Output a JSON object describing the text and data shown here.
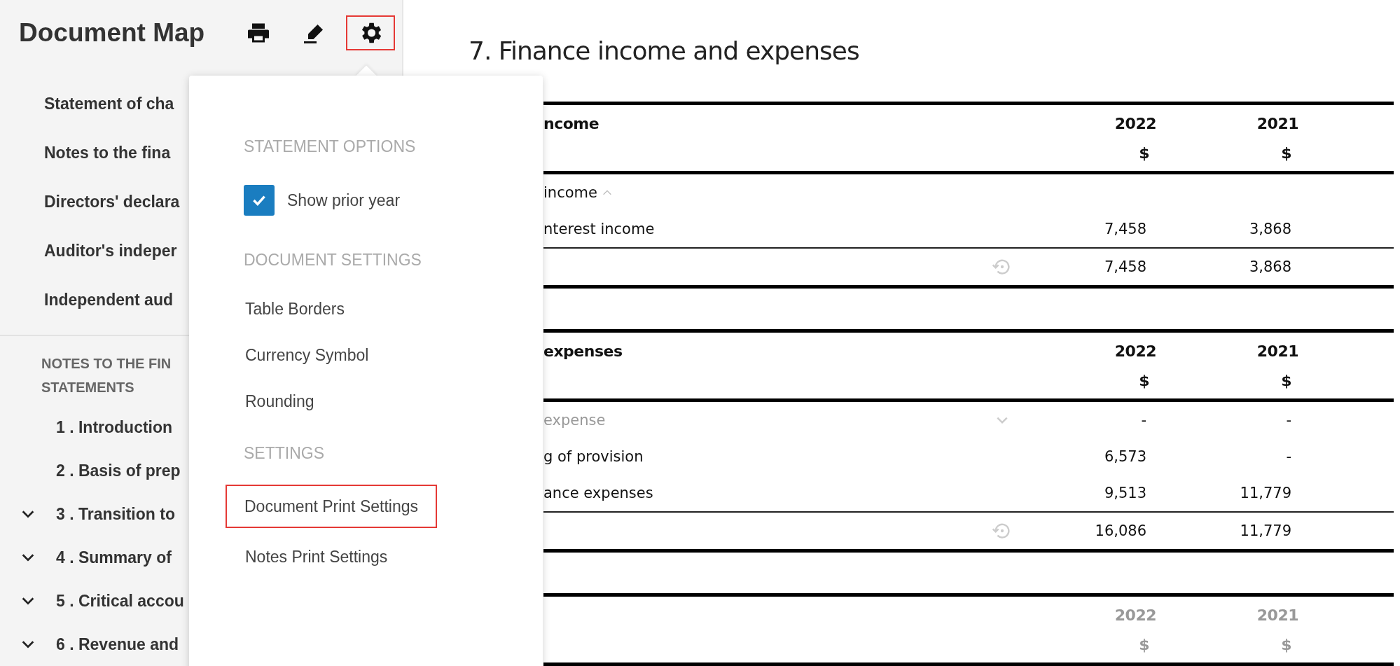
{
  "sidebar": {
    "title": "Document Map",
    "toolbar": [
      {
        "kind": "print",
        "selected": false
      },
      {
        "kind": "edit",
        "selected": false
      },
      {
        "kind": "settings",
        "selected": true
      }
    ],
    "items": [
      {
        "label": "Statement of cha"
      },
      {
        "label": "Notes to the fina"
      },
      {
        "label": "Directors' declara"
      },
      {
        "label": "Auditor's indeper"
      },
      {
        "label": "Independent aud"
      }
    ],
    "section": [
      "NOTES TO THE FIN",
      "STATEMENTS"
    ],
    "notes": [
      {
        "label": "1 . Introduction",
        "kind": "leaf"
      },
      {
        "label": "2 . Basis of prep",
        "kind": "leaf"
      },
      {
        "label": "3 . Transition to",
        "kind": "group"
      },
      {
        "label": "4 . Summary of",
        "kind": "group"
      },
      {
        "label": "5 . Critical accou",
        "kind": "group"
      },
      {
        "label": "6 . Revenue and",
        "kind": "group"
      }
    ]
  },
  "popover": {
    "sections": [
      {
        "heading": "STATEMENT OPTIONS",
        "items": [
          {
            "kind": "checkbox",
            "label": "Show prior year",
            "checked": true
          }
        ]
      },
      {
        "heading": "DOCUMENT SETTINGS",
        "items": [
          {
            "kind": "link",
            "label": "Table Borders",
            "highlighted": false
          },
          {
            "kind": "link",
            "label": "Currency Symbol",
            "highlighted": false
          },
          {
            "kind": "link",
            "label": "Rounding",
            "highlighted": false
          }
        ]
      },
      {
        "heading": "SETTINGS",
        "items": [
          {
            "kind": "link",
            "label": "Document Print Settings",
            "highlighted": true
          },
          {
            "kind": "link",
            "label": "Notes Print Settings",
            "highlighted": false
          }
        ]
      }
    ]
  },
  "main": {
    "title": "7. Finance income and expenses",
    "tables": [
      {
        "header": {
          "label": "ncome",
          "muted": false,
          "years": [
            "2022",
            "2021"
          ],
          "units": [
            "$",
            "$"
          ]
        },
        "rows": [
          {
            "kind": "group",
            "label": "income",
            "expanded": true
          },
          {
            "kind": "line",
            "label": "nterest income",
            "values": [
              "7,458",
              "3,868"
            ]
          },
          {
            "kind": "total",
            "values": [
              "7,458",
              "3,868"
            ]
          }
        ]
      },
      {
        "header": {
          "label": "expenses",
          "muted": false,
          "years": [
            "2022",
            "2021"
          ],
          "units": [
            "$",
            "$"
          ]
        },
        "rows": [
          {
            "kind": "hidden",
            "label": "expense",
            "values": [
              "-",
              "-"
            ]
          },
          {
            "kind": "line",
            "label": "g of provision",
            "values": [
              "6,573",
              "-"
            ]
          },
          {
            "kind": "line",
            "label": "ance expenses",
            "values": [
              "9,513",
              "11,779"
            ]
          },
          {
            "kind": "total",
            "values": [
              "16,086",
              "11,779"
            ]
          }
        ]
      },
      {
        "header": {
          "muted": true,
          "years": [
            "2022",
            "2021"
          ],
          "units": [
            "$",
            "$"
          ]
        }
      }
    ]
  }
}
